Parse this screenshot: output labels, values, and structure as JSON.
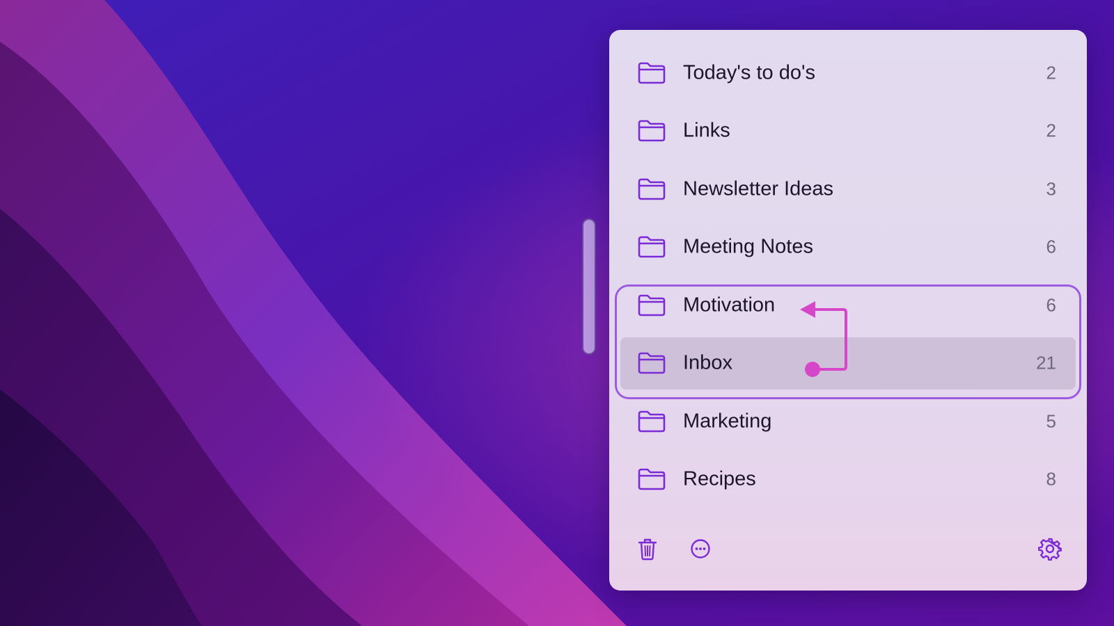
{
  "folders": [
    {
      "label": "Today's to do's",
      "count": "2"
    },
    {
      "label": "Links",
      "count": "2"
    },
    {
      "label": "Newsletter Ideas",
      "count": "3"
    },
    {
      "label": "Meeting Notes",
      "count": "6"
    },
    {
      "label": "Motivation",
      "count": "6"
    },
    {
      "label": "Inbox",
      "count": "21",
      "selected": true
    },
    {
      "label": "Marketing",
      "count": "5"
    },
    {
      "label": "Recipes",
      "count": "8"
    }
  ],
  "toolbar": {
    "left_icons": [
      "trash-icon",
      "more-options-icon"
    ],
    "right_icons": [
      "gear-icon"
    ]
  },
  "colors": {
    "accent": "#7b2bd6",
    "annotation": "#d646c8",
    "highlight_border": "#9d5be0",
    "selected_row": "#cdc0d8",
    "panel_bg": "#e3dbef"
  }
}
